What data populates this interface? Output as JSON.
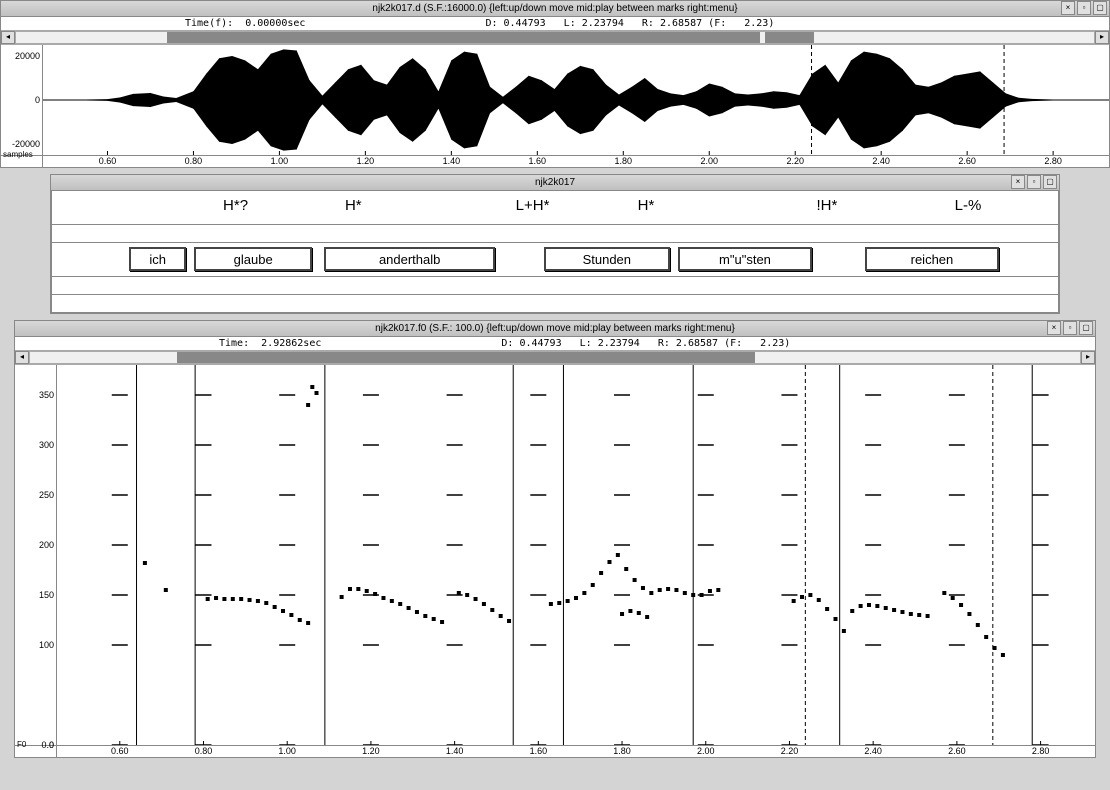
{
  "waveform": {
    "title": "njk2k017.d (S.F.:16000.0) {left:up/down move  mid:play between marks  right:menu}",
    "info": {
      "time_label": "Time(f):",
      "time_val": "0.00000sec",
      "d_label": "D:",
      "d_val": "0.44793",
      "l_label": "L:",
      "l_val": "2.23794",
      "r_label": "R:",
      "r_val": "2.68587",
      "f_label": "(F:",
      "f_val": "2.23)"
    },
    "x_axis": {
      "min": 0.45,
      "max": 2.93,
      "ticks": [
        0.6,
        0.8,
        1.0,
        1.2,
        1.4,
        1.6,
        1.8,
        2.0,
        2.2,
        2.4,
        2.6,
        2.8
      ]
    },
    "y_axis": {
      "ticks": [
        20000,
        0,
        -20000
      ],
      "corner": "samples"
    },
    "markers": {
      "L": 2.23794,
      "R": 2.68587
    },
    "scroll": {
      "seg1": {
        "left_pct": 14,
        "width_pct": 55
      },
      "seg2": {
        "left_pct": 69.5,
        "width_pct": 4.5
      }
    },
    "envelope": [
      [
        0.5,
        150
      ],
      [
        0.55,
        200
      ],
      [
        0.6,
        400
      ],
      [
        0.63,
        1200
      ],
      [
        0.66,
        2800
      ],
      [
        0.7,
        3200
      ],
      [
        0.73,
        1600
      ],
      [
        0.76,
        900
      ],
      [
        0.8,
        4000
      ],
      [
        0.83,
        12000
      ],
      [
        0.86,
        19000
      ],
      [
        0.89,
        20000
      ],
      [
        0.92,
        18000
      ],
      [
        0.95,
        14000
      ],
      [
        0.98,
        21000
      ],
      [
        1.01,
        23000
      ],
      [
        1.04,
        22500
      ],
      [
        1.07,
        9000
      ],
      [
        1.1,
        2000
      ],
      [
        1.13,
        8000
      ],
      [
        1.16,
        14000
      ],
      [
        1.19,
        16000
      ],
      [
        1.22,
        9000
      ],
      [
        1.25,
        7000
      ],
      [
        1.28,
        15000
      ],
      [
        1.31,
        19000
      ],
      [
        1.34,
        14000
      ],
      [
        1.37,
        4000
      ],
      [
        1.4,
        18000
      ],
      [
        1.43,
        22000
      ],
      [
        1.46,
        21000
      ],
      [
        1.49,
        6000
      ],
      [
        1.52,
        1500
      ],
      [
        1.55,
        6000
      ],
      [
        1.58,
        11000
      ],
      [
        1.61,
        9000
      ],
      [
        1.64,
        5000
      ],
      [
        1.67,
        12000
      ],
      [
        1.7,
        15500
      ],
      [
        1.73,
        14000
      ],
      [
        1.76,
        7000
      ],
      [
        1.79,
        2500
      ],
      [
        1.82,
        6000
      ],
      [
        1.85,
        10000
      ],
      [
        1.88,
        5000
      ],
      [
        1.91,
        3000
      ],
      [
        1.94,
        2200
      ],
      [
        1.97,
        4000
      ],
      [
        2.0,
        7500
      ],
      [
        2.03,
        6000
      ],
      [
        2.06,
        3000
      ],
      [
        2.09,
        2500
      ],
      [
        2.12,
        3000
      ],
      [
        2.15,
        4000
      ],
      [
        2.18,
        3500
      ],
      [
        2.21,
        2200
      ],
      [
        2.24,
        12000
      ],
      [
        2.27,
        16000
      ],
      [
        2.3,
        8000
      ],
      [
        2.33,
        18000
      ],
      [
        2.36,
        22000
      ],
      [
        2.39,
        21000
      ],
      [
        2.42,
        19000
      ],
      [
        2.45,
        14000
      ],
      [
        2.48,
        7000
      ],
      [
        2.51,
        6000
      ],
      [
        2.54,
        8000
      ],
      [
        2.57,
        11000
      ],
      [
        2.6,
        12000
      ],
      [
        2.63,
        13000
      ],
      [
        2.66,
        8000
      ],
      [
        2.69,
        3000
      ],
      [
        2.72,
        1000
      ],
      [
        2.75,
        500
      ],
      [
        2.8,
        200
      ],
      [
        2.9,
        100
      ]
    ]
  },
  "annotation": {
    "title": "njk2k017",
    "tones": [
      {
        "label": "H*?",
        "time": 0.92
      },
      {
        "label": "H*",
        "time": 1.22
      },
      {
        "label": "L+H*",
        "time": 1.64
      },
      {
        "label": "H*",
        "time": 1.94
      },
      {
        "label": "!H*",
        "time": 2.38
      },
      {
        "label": "L-%",
        "time": 2.72
      }
    ],
    "words": [
      {
        "label": "ich",
        "start": 0.64,
        "end": 0.78
      },
      {
        "label": "glaube",
        "start": 0.8,
        "end": 1.09
      },
      {
        "label": "anderthalb",
        "start": 1.12,
        "end": 1.54
      },
      {
        "label": "Stunden",
        "start": 1.66,
        "end": 1.97
      },
      {
        "label": "m\"u\"sten",
        "start": 1.99,
        "end": 2.32
      },
      {
        "label": "reichen",
        "start": 2.45,
        "end": 2.78
      }
    ]
  },
  "f0": {
    "title": "njk2k017.f0 (S.F.:  100.0) {left:up/down move  mid:play between marks  right:menu}",
    "info": {
      "time_label": "Time:",
      "time_val": "2.92862sec",
      "d_label": "D:",
      "d_val": "0.44793",
      "l_label": "L:",
      "l_val": "2.23794",
      "r_label": "R:",
      "r_val": "2.68587",
      "f_label": "(F:",
      "f_val": "2.23)"
    },
    "x_axis": {
      "min": 0.45,
      "max": 2.93,
      "ticks": [
        0.6,
        0.8,
        1.0,
        1.2,
        1.4,
        1.6,
        1.8,
        2.0,
        2.2,
        2.4,
        2.6,
        2.8
      ]
    },
    "y_axis": {
      "min": 0,
      "max": 380,
      "ticks": [
        350,
        300,
        250,
        200,
        150,
        100,
        0
      ],
      "corner": "F0"
    },
    "markers": {
      "L": 2.23794,
      "R": 2.68587
    },
    "word_boundaries": [
      0.64,
      0.78,
      1.09,
      1.54,
      1.66,
      1.97,
      2.32,
      2.78
    ],
    "points": [
      [
        0.66,
        182
      ],
      [
        0.71,
        155
      ],
      [
        0.81,
        146
      ],
      [
        0.83,
        147
      ],
      [
        0.85,
        146
      ],
      [
        0.87,
        146
      ],
      [
        0.89,
        146
      ],
      [
        0.91,
        145
      ],
      [
        0.93,
        144
      ],
      [
        0.95,
        142
      ],
      [
        0.97,
        138
      ],
      [
        0.99,
        134
      ],
      [
        1.01,
        130
      ],
      [
        1.03,
        125
      ],
      [
        1.05,
        122
      ],
      [
        1.05,
        340
      ],
      [
        1.06,
        358
      ],
      [
        1.07,
        352
      ],
      [
        1.13,
        148
      ],
      [
        1.15,
        156
      ],
      [
        1.17,
        156
      ],
      [
        1.19,
        154
      ],
      [
        1.21,
        151
      ],
      [
        1.23,
        147
      ],
      [
        1.25,
        144
      ],
      [
        1.27,
        141
      ],
      [
        1.29,
        137
      ],
      [
        1.31,
        133
      ],
      [
        1.33,
        129
      ],
      [
        1.35,
        126
      ],
      [
        1.37,
        123
      ],
      [
        1.41,
        152
      ],
      [
        1.43,
        150
      ],
      [
        1.45,
        146
      ],
      [
        1.47,
        141
      ],
      [
        1.49,
        135
      ],
      [
        1.51,
        129
      ],
      [
        1.53,
        124
      ],
      [
        1.63,
        141
      ],
      [
        1.65,
        142
      ],
      [
        1.67,
        144
      ],
      [
        1.69,
        147
      ],
      [
        1.71,
        152
      ],
      [
        1.73,
        160
      ],
      [
        1.75,
        172
      ],
      [
        1.77,
        183
      ],
      [
        1.79,
        190
      ],
      [
        1.81,
        176
      ],
      [
        1.83,
        165
      ],
      [
        1.85,
        157
      ],
      [
        1.8,
        131
      ],
      [
        1.82,
        134
      ],
      [
        1.84,
        132
      ],
      [
        1.86,
        128
      ],
      [
        1.87,
        152
      ],
      [
        1.89,
        155
      ],
      [
        1.91,
        156
      ],
      [
        1.93,
        155
      ],
      [
        1.95,
        152
      ],
      [
        1.97,
        150
      ],
      [
        1.99,
        150
      ],
      [
        2.01,
        154
      ],
      [
        2.03,
        155
      ],
      [
        2.21,
        144
      ],
      [
        2.23,
        148
      ],
      [
        2.25,
        150
      ],
      [
        2.27,
        145
      ],
      [
        2.29,
        136
      ],
      [
        2.31,
        126
      ],
      [
        2.33,
        114
      ],
      [
        2.35,
        134
      ],
      [
        2.37,
        139
      ],
      [
        2.39,
        140
      ],
      [
        2.41,
        139
      ],
      [
        2.43,
        137
      ],
      [
        2.45,
        135
      ],
      [
        2.47,
        133
      ],
      [
        2.49,
        131
      ],
      [
        2.51,
        130
      ],
      [
        2.53,
        129
      ],
      [
        2.57,
        152
      ],
      [
        2.59,
        147
      ],
      [
        2.61,
        140
      ],
      [
        2.63,
        131
      ],
      [
        2.65,
        120
      ],
      [
        2.67,
        108
      ],
      [
        2.69,
        97
      ],
      [
        2.71,
        90
      ]
    ]
  },
  "win_controls": [
    "×",
    "▫",
    "▢"
  ]
}
